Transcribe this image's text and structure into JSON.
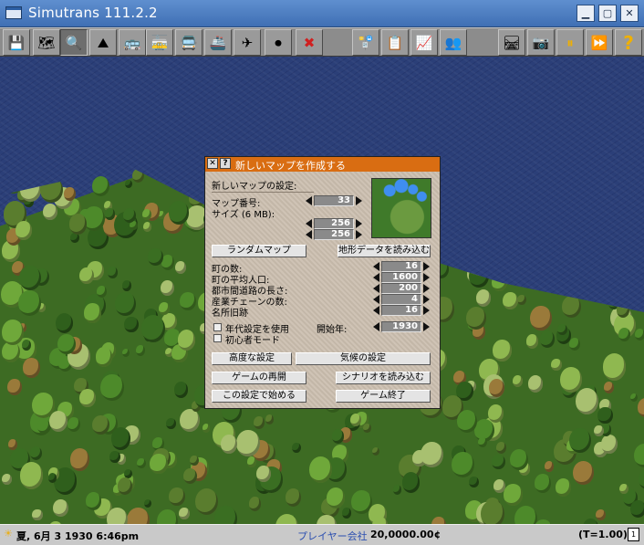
{
  "window": {
    "title": "Simutrans 111.2.2"
  },
  "toolbar": {
    "tools": [
      {
        "name": "save-disk-icon",
        "glyph": "💾"
      },
      {
        "name": "terrain-icon",
        "glyph": "🗺"
      },
      {
        "name": "magnifier-icon",
        "glyph": "🔍"
      },
      {
        "name": "landscape-icon",
        "glyph": "⛰"
      },
      {
        "name": "road-vehicle-icon",
        "glyph": "🚌"
      },
      {
        "name": "tram-icon",
        "glyph": "🚋"
      },
      {
        "name": "bus-icon",
        "glyph": "🚍"
      },
      {
        "name": "ship-icon",
        "glyph": "🚢"
      },
      {
        "name": "airplane-icon",
        "glyph": "✈"
      },
      {
        "name": "stop-icon",
        "glyph": "⏺"
      },
      {
        "name": "remove-icon",
        "glyph": "✖"
      },
      {
        "name": "lines-icon",
        "glyph": "🚏"
      },
      {
        "name": "list-icon",
        "glyph": "📋"
      },
      {
        "name": "finance-icon",
        "glyph": "📈"
      },
      {
        "name": "player-icon",
        "glyph": "👥"
      },
      {
        "name": "map-rail-icon",
        "glyph": "🛤"
      },
      {
        "name": "camera-icon",
        "glyph": "📷"
      },
      {
        "name": "pause-icon",
        "glyph": "⏸"
      },
      {
        "name": "fast-forward-icon",
        "glyph": "⏩"
      },
      {
        "name": "help-icon",
        "glyph": "?"
      }
    ]
  },
  "dialog": {
    "title": "新しいマップを作成する",
    "section_title": "新しいマップの設定:",
    "map_number_label": "マップ番号:",
    "map_number": "33",
    "size_label": "サイズ (6 MB):",
    "size_x": "256",
    "size_y": "256",
    "random_map_button": "ランダムマップ",
    "load_heightmap_button": "地形データを読み込む",
    "towns_label": "町の数:",
    "towns": "16",
    "avg_population_label": "町の平均人口:",
    "avg_population": "1600",
    "intercity_road_label": "都市間道路の長さ:",
    "intercity_road": "200",
    "industry_chains_label": "産業チェーンの数:",
    "industry_chains": "4",
    "landmarks_label": "名所旧跡",
    "landmarks": "16",
    "use_timeline_label": "年代設定を使用",
    "start_year_label": "開始年:",
    "start_year": "1930",
    "beginner_mode_label": "初心者モード",
    "advanced_settings_button": "高度な設定",
    "climate_settings_button": "気候の設定",
    "resume_game_button": "ゲームの再開",
    "load_scenario_button": "シナリオを読み込む",
    "start_with_settings_button": "この設定で始める",
    "quit_game_button": "ゲーム終了"
  },
  "status": {
    "date": "夏, 6月 3 1930  6:46pm",
    "company": "プレイヤー会社",
    "money": "20,0000.00¢",
    "speed": "(T=1.00)"
  },
  "colors": {
    "dialog_titlebar": "#d96d12",
    "sea": "#2b3f78",
    "money": "#000000",
    "company": "#2c4fb0"
  }
}
